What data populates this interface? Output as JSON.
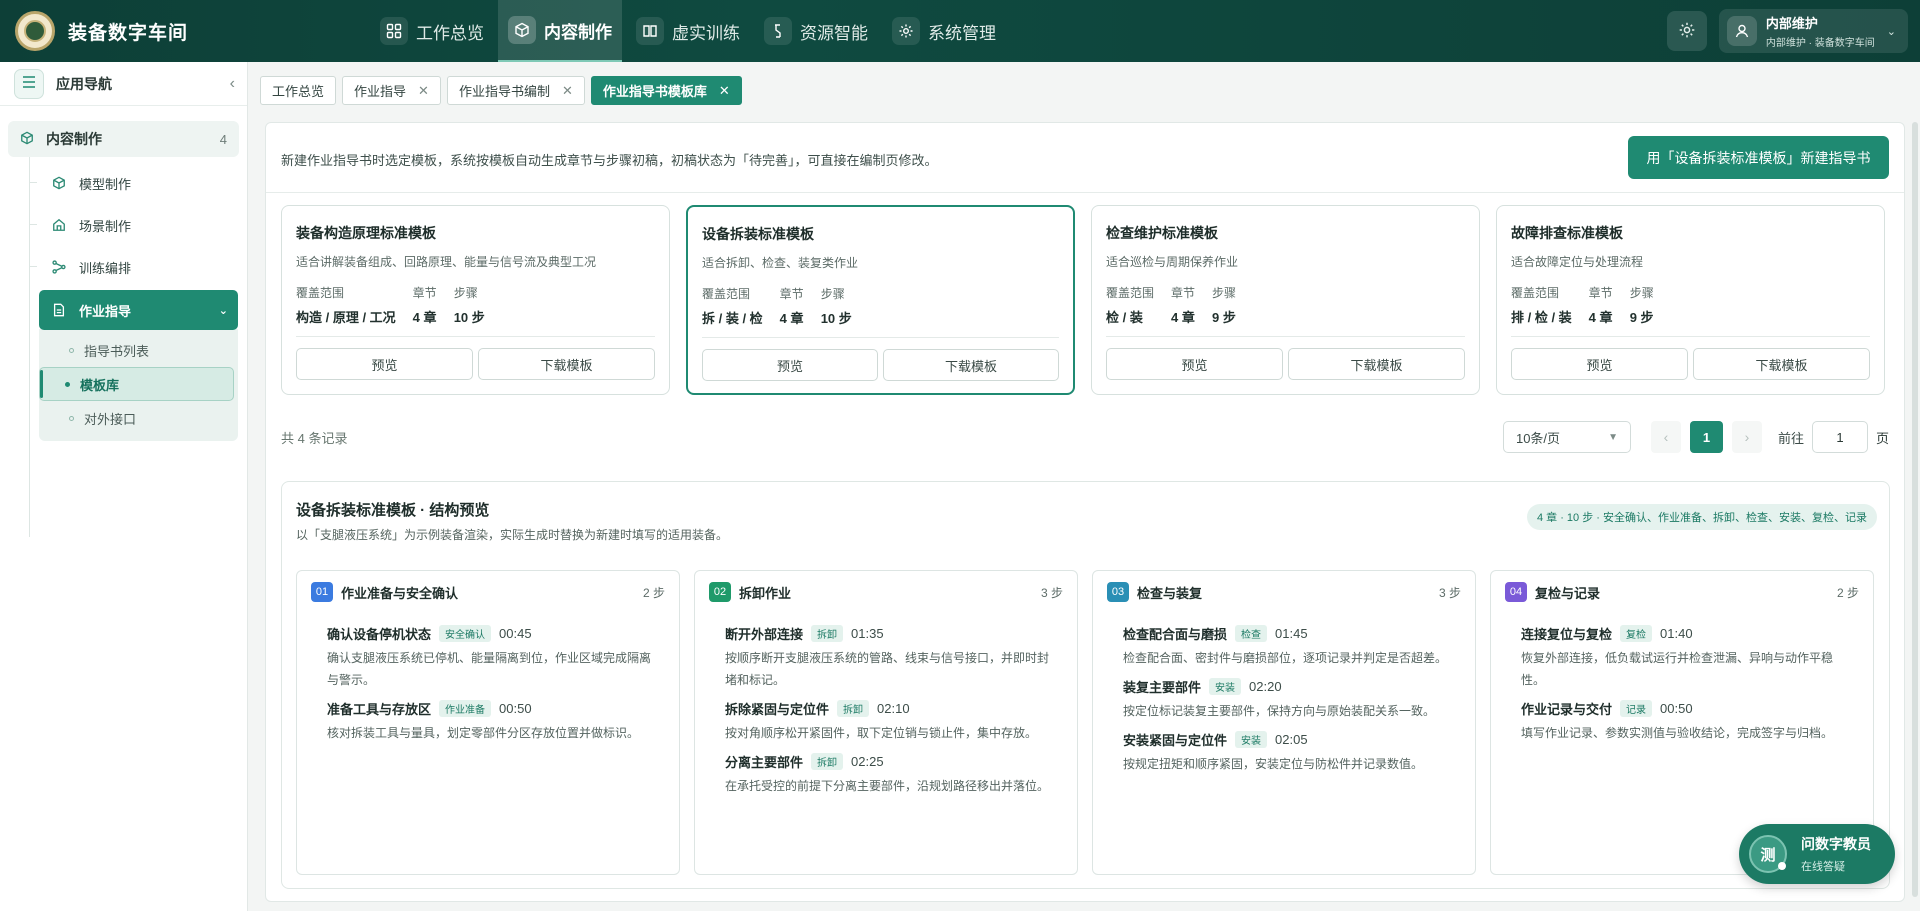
{
  "app": {
    "title": "装备数字车间"
  },
  "nav": [
    {
      "label": "工作总览",
      "icon": "grid-icon"
    },
    {
      "label": "内容制作",
      "icon": "cube-icon",
      "active": true
    },
    {
      "label": "虚实训练",
      "icon": "book-icon"
    },
    {
      "label": "资源智能",
      "icon": "plug-icon"
    },
    {
      "label": "系统管理",
      "icon": "gear-icon"
    }
  ],
  "user": {
    "name": "内部维护",
    "sub": "内部维护 · 装备数字车间"
  },
  "sidebar": {
    "title": "应用导航",
    "group": {
      "label": "内容制作",
      "count": "4"
    },
    "items": [
      {
        "label": "模型制作",
        "icon": "cube-icon"
      },
      {
        "label": "场景制作",
        "icon": "home-icon"
      },
      {
        "label": "训练编排",
        "icon": "flow-icon"
      },
      {
        "label": "作业指导",
        "icon": "doc-icon",
        "active": true
      }
    ],
    "subitems": [
      {
        "label": "指导书列表"
      },
      {
        "label": "模板库",
        "active": true
      },
      {
        "label": "对外接口"
      }
    ]
  },
  "tabs": [
    {
      "label": "工作总览",
      "closable": false
    },
    {
      "label": "作业指导",
      "closable": true
    },
    {
      "label": "作业指导书编制",
      "closable": true
    },
    {
      "label": "作业指导书模板库",
      "closable": true,
      "active": true
    }
  ],
  "main": {
    "intro": "新建作业指导书时选定模板，系统按模板自动生成章节与步骤初稿，初稿状态为「待完善」，可直接在编制页修改。",
    "new_button": "用「设备拆装标准模板」新建指导书"
  },
  "stat_labels": {
    "scope": "覆盖范围",
    "chapters": "章节",
    "steps": "步骤"
  },
  "card_buttons": {
    "preview": "预览",
    "download": "下载模板"
  },
  "templates": [
    {
      "title": "装备构造原理标准模板",
      "desc": "适合讲解装备组成、回路原理、能量与信号流及典型工况",
      "scope": "构造 / 原理 / 工况",
      "chapters": "4 章",
      "steps": "10 步"
    },
    {
      "title": "设备拆装标准模板",
      "desc": "适合拆卸、检查、装复类作业",
      "scope": "拆 / 装 / 检",
      "chapters": "4 章",
      "steps": "10 步",
      "selected": true
    },
    {
      "title": "检查维护标准模板",
      "desc": "适合巡检与周期保养作业",
      "scope": "检 / 装",
      "chapters": "4 章",
      "steps": "9 步"
    },
    {
      "title": "故障排查标准模板",
      "desc": "适合故障定位与处理流程",
      "scope": "排 / 检 / 装",
      "chapters": "4 章",
      "steps": "9 步"
    }
  ],
  "pagination": {
    "total": "共 4 条记录",
    "page_size": "10条/页",
    "current": "1",
    "goto_label": "前往",
    "goto_value": "1",
    "page_unit": "页"
  },
  "preview": {
    "title": "设备拆装标准模板 · 结构预览",
    "subtitle": "以「支腿液压系统」为示例装备渲染，实际生成时替换为新建时填写的适用装备。",
    "badge": "4 章 · 10 步 · 安全确认、作业准备、拆卸、检查、安装、复检、记录",
    "columns": [
      {
        "num": "01",
        "color": "#3b7be0",
        "title": "作业准备与安全确认",
        "count": "2 步",
        "steps": [
          {
            "name": "确认设备停机状态",
            "tag": "安全确认",
            "time": "00:45",
            "desc": "确认支腿液压系统已停机、能量隔离到位，作业区域完成隔离与警示。"
          },
          {
            "name": "准备工具与存放区",
            "tag": "作业准备",
            "time": "00:50",
            "desc": "核对拆装工具与量具，划定零部件分区存放位置并做标识。"
          }
        ]
      },
      {
        "num": "02",
        "color": "#1f9a6a",
        "title": "拆卸作业",
        "count": "3 步",
        "steps": [
          {
            "name": "断开外部连接",
            "tag": "拆卸",
            "time": "01:35",
            "desc": "按顺序断开支腿液压系统的管路、线束与信号接口，并即时封堵和标记。"
          },
          {
            "name": "拆除紧固与定位件",
            "tag": "拆卸",
            "time": "02:10",
            "desc": "按对角顺序松开紧固件，取下定位销与锁止件，集中存放。"
          },
          {
            "name": "分离主要部件",
            "tag": "拆卸",
            "time": "02:25",
            "desc": "在承托受控的前提下分离主要部件，沿规划路径移出并落位。"
          }
        ]
      },
      {
        "num": "03",
        "color": "#2a8fb5",
        "title": "检查与装复",
        "count": "3 步",
        "steps": [
          {
            "name": "检查配合面与磨损",
            "tag": "检查",
            "time": "01:45",
            "desc": "检查配合面、密封件与磨损部位，逐项记录并判定是否超差。"
          },
          {
            "name": "装复主要部件",
            "tag": "安装",
            "time": "02:20",
            "desc": "按定位标记装复主要部件，保持方向与原始装配关系一致。"
          },
          {
            "name": "安装紧固与定位件",
            "tag": "安装",
            "time": "02:05",
            "desc": "按规定扭矩和顺序紧固，安装定位与防松件并记录数值。"
          }
        ]
      },
      {
        "num": "04",
        "color": "#7a5ad8",
        "title": "复检与记录",
        "count": "2 步",
        "steps": [
          {
            "name": "连接复位与复检",
            "tag": "复检",
            "time": "01:40",
            "desc": "恢复外部连接，低负载试运行并检查泄漏、异响与动作平稳性。"
          },
          {
            "name": "作业记录与交付",
            "tag": "记录",
            "time": "00:50",
            "desc": "填写作业记录、参数实测值与验收结论，完成签字与归档。"
          }
        ]
      }
    ]
  },
  "assistant": {
    "avatar": "测",
    "name": "问数字教员",
    "status": "在线答疑"
  }
}
